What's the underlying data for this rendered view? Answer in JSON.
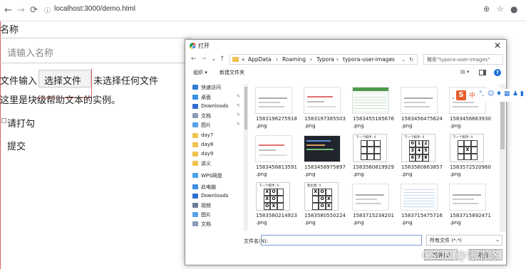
{
  "browser": {
    "url": "localhost:3000/demo.html",
    "back_icon": "arrow-left-icon",
    "forward_icon": "arrow-right-icon",
    "reload_icon": "reload-icon"
  },
  "form": {
    "name_label": "名称",
    "name_placeholder": "请输入名称",
    "file_label": "文件输入",
    "file_button": "选择文件",
    "file_status": "未选择任何文件",
    "help_text": "这里是块级帮助文本的实例。",
    "checkbox_label": "请打勾",
    "submit_label": "提交"
  },
  "dialog": {
    "title": "打开",
    "close": "✕",
    "breadcrumb": [
      "«",
      "AppData",
      "›",
      "Roaming",
      "›",
      "Typora",
      "›",
      "typora-user-images"
    ],
    "search_placeholder": "搜索\"typora-user-images\"",
    "organize": "组织 ▾",
    "new_folder": "新建文件夹",
    "sidebar": [
      {
        "label": "快速访问",
        "icon": "star-icon",
        "color": "#2f7bd6",
        "pin": false
      },
      {
        "label": "桌面",
        "icon": "desktop-icon",
        "color": "#3b8ee0",
        "pin": true
      },
      {
        "label": "Downloads",
        "icon": "download-icon",
        "color": "#2f6fcf",
        "pin": true
      },
      {
        "label": "文档",
        "icon": "document-icon",
        "color": "#8a9bb5",
        "pin": true
      },
      {
        "label": "图片",
        "icon": "picture-icon",
        "color": "#5aa0e8",
        "pin": true
      },
      {
        "label": "day7",
        "icon": "folder-icon",
        "color": "#f0c350",
        "pin": false
      },
      {
        "label": "day8",
        "icon": "folder-icon",
        "color": "#f0c350",
        "pin": false
      },
      {
        "label": "day9",
        "icon": "folder-icon",
        "color": "#f0c350",
        "pin": false
      },
      {
        "label": "讲义",
        "icon": "folder-icon",
        "color": "#f0c350",
        "pin": false
      },
      {
        "label": "WPS网盘",
        "icon": "cloud-icon",
        "color": "#4aa3e8",
        "pin": false
      },
      {
        "label": "此电脑",
        "icon": "computer-icon",
        "color": "#3b8ee0",
        "pin": false
      },
      {
        "label": "Downloads",
        "icon": "download-icon",
        "color": "#2f6fcf",
        "pin": false
      },
      {
        "label": "视频",
        "icon": "video-icon",
        "color": "#6a7d96",
        "pin": false
      },
      {
        "label": "图片",
        "icon": "picture-icon",
        "color": "#5aa0e8",
        "pin": false
      },
      {
        "label": "文档",
        "icon": "document-icon",
        "color": "#8a9bb5",
        "pin": false
      }
    ],
    "files": [
      {
        "name1": "1583196275918",
        "name2": ".png",
        "kind": "doc"
      },
      {
        "name1": "1583197385503",
        "name2": ".png",
        "kind": "doc-red"
      },
      {
        "name1": "1583455185676",
        "name2": ".png",
        "kind": "code-green"
      },
      {
        "name1": "1583456475624",
        "name2": ".png",
        "kind": "doc"
      },
      {
        "name1": "1583456663930",
        "name2": ".png",
        "kind": "doc"
      },
      {
        "name1": "1583456813591",
        "name2": ".png",
        "kind": "doc-red"
      },
      {
        "name1": "1583458975897",
        "name2": ".png",
        "kind": "dark"
      },
      {
        "name1": "1583560819929",
        "name2": ".png",
        "kind": "ttt-empty"
      },
      {
        "name1": "1583560863857",
        "name2": ".png",
        "kind": "ttt-nums"
      },
      {
        "name1": "1583572520960",
        "name2": ".png",
        "kind": "ttt-x"
      },
      {
        "name1": "1583580214923",
        "name2": ".png",
        "kind": "ttt-xo"
      },
      {
        "name1": "1583580550224",
        "name2": ".png",
        "kind": "ttt-xo2"
      },
      {
        "name1": "1583715238201",
        "name2": ".png",
        "kind": "doc"
      },
      {
        "name1": "1583715475716",
        "name2": ".png",
        "kind": "code-blue"
      },
      {
        "name1": "1583715892471",
        "name2": ".png",
        "kind": "doc"
      }
    ],
    "ttt": {
      "caption_next": "下一个棋手: X",
      "caption_winner": "胜出者: X",
      "nums": [
        "0",
        "1",
        "2",
        "3",
        "4",
        "5",
        "6",
        "7",
        "8"
      ],
      "x_board": [
        "",
        "",
        "",
        "",
        "X",
        "",
        "",
        "",
        ""
      ],
      "xo_board": [
        "X",
        "O",
        "",
        "X",
        "O",
        "",
        "O",
        "X",
        ""
      ],
      "xo2_board": [
        "X",
        "O",
        "",
        "",
        "O",
        "X",
        "",
        "O",
        "X"
      ]
    },
    "filename_label": "文件名(N):",
    "filetype": "所有文件 (*.*)",
    "open_button": "打开(O)",
    "cancel_button": "取消"
  },
  "watermark": "CSDN @张清悠"
}
